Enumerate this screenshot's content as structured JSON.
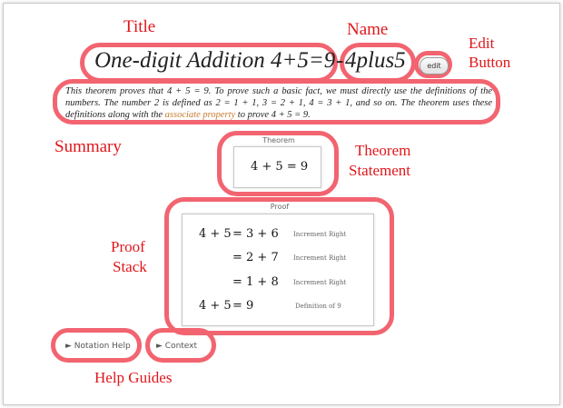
{
  "theorem": {
    "title": "One-digit Addition 4+5=9",
    "separator": "-",
    "name": "4plus5",
    "edit_label": "edit",
    "summary_before": "This theorem proves that 4 + 5 = 9. To prove such a basic fact, we must directly use the definitions of the numbers. The number 2 is defined as 2 = 1 + 1, 3 = 2 + 1, 4 = 3 + 1, and so on. The theorem uses these definitions along with the ",
    "summary_link": "associate property",
    "summary_after": " to prove 4 + 5 = 9.",
    "statement_header": "Theorem",
    "statement": "4 + 5 = 9"
  },
  "proof": {
    "header": "Proof",
    "steps": [
      {
        "lhs": "4 + 5",
        "rhs": "= 3 + 6",
        "justification": "Increment Right"
      },
      {
        "lhs": "",
        "rhs": "= 2 + 7",
        "justification": "Increment Right"
      },
      {
        "lhs": "",
        "rhs": "= 1 + 8",
        "justification": "Increment Right"
      },
      {
        "lhs": "4 + 5",
        "rhs": "= 9",
        "justification": "Definition of 9"
      }
    ]
  },
  "help": {
    "notation": "► Notation Help",
    "context": "► Context"
  },
  "annotations": {
    "title": "Title",
    "name": "Name",
    "edit_line1": "Edit",
    "edit_line2": "Button",
    "summary": "Summary",
    "theorem_line1": "Theorem",
    "theorem_line2": "Statement",
    "proof_line1": "Proof",
    "proof_line2": "Stack",
    "help": "Help Guides"
  },
  "colors": {
    "annotation": "#e0161b",
    "ring": "#f26470",
    "link": "#c87a2e"
  }
}
